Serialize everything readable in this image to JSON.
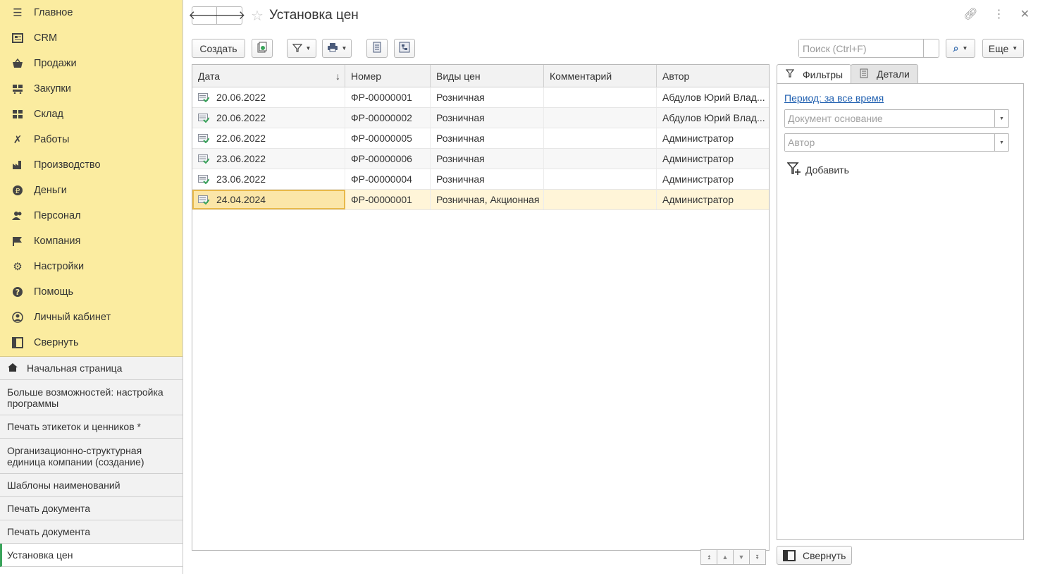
{
  "sidebar": {
    "sections": [
      {
        "label": "Главное",
        "icon": "menu-icon"
      },
      {
        "label": "CRM",
        "icon": "crm-icon"
      },
      {
        "label": "Продажи",
        "icon": "basket-icon"
      },
      {
        "label": "Закупки",
        "icon": "purchases-icon"
      },
      {
        "label": "Склад",
        "icon": "warehouse-icon"
      },
      {
        "label": "Работы",
        "icon": "tools-icon"
      },
      {
        "label": "Производство",
        "icon": "factory-icon"
      },
      {
        "label": "Деньги",
        "icon": "ruble-icon"
      },
      {
        "label": "Персонал",
        "icon": "people-icon"
      },
      {
        "label": "Компания",
        "icon": "flag-icon"
      },
      {
        "label": "Настройки",
        "icon": "gear-icon"
      },
      {
        "label": "Помощь",
        "icon": "help-icon"
      },
      {
        "label": "Личный кабинет",
        "icon": "user-circle-icon"
      },
      {
        "label": "Свернуть",
        "icon": "collapse-icon"
      }
    ],
    "history": [
      {
        "label": "Начальная страница",
        "type": "home"
      },
      {
        "label": "Больше возможностей: настройка программы",
        "type": "double"
      },
      {
        "label": "Печать этикеток и ценников *",
        "type": "single"
      },
      {
        "label": "Организационно-структурная единица компании (создание)",
        "type": "double"
      },
      {
        "label": "Шаблоны наименований",
        "type": "single"
      },
      {
        "label": "Печать документа",
        "type": "single"
      },
      {
        "label": "Печать документа",
        "type": "single"
      },
      {
        "label": "Установка цен",
        "type": "active"
      }
    ]
  },
  "header": {
    "title": "Установка цен",
    "back_icon": "arrow-left-icon",
    "forward_icon": "arrow-right-icon"
  },
  "toolbar": {
    "create_label": "Создать",
    "search_placeholder": "Поиск (Ctrl+F)",
    "more_label": "Еще"
  },
  "table": {
    "columns": [
      "Дата",
      "Номер",
      "Виды цен",
      "Комментарий",
      "Автор"
    ],
    "sorted_column": "Дата",
    "sort_direction": "descending",
    "rows": [
      {
        "date": "20.06.2022",
        "number": "ФР-00000001",
        "price_types": "Розничная",
        "comment": "",
        "author": "Абдулов Юрий Влад..."
      },
      {
        "date": "20.06.2022",
        "number": "ФР-00000002",
        "price_types": "Розничная",
        "comment": "",
        "author": "Абдулов Юрий Влад..."
      },
      {
        "date": "22.06.2022",
        "number": "ФР-00000005",
        "price_types": "Розничная",
        "comment": "",
        "author": "Администратор"
      },
      {
        "date": "23.06.2022",
        "number": "ФР-00000006",
        "price_types": "Розничная",
        "comment": "",
        "author": "Администратор"
      },
      {
        "date": "23.06.2022",
        "number": "ФР-00000004",
        "price_types": "Розничная",
        "comment": "",
        "author": "Администратор"
      },
      {
        "date": "24.04.2024",
        "number": "ФР-00000001",
        "price_types": "Розничная, Акционная",
        "comment": "",
        "author": "Администратор"
      }
    ],
    "selected_row": 5
  },
  "panel": {
    "tab_filters": "Фильтры",
    "tab_details": "Детали",
    "period_link": "Период: за все время",
    "doc_basis_placeholder": "Документ основание",
    "author_placeholder": "Автор",
    "add_label": "Добавить",
    "collapse_label": "Свернуть"
  },
  "colors": {
    "sidebar_bg": "#fbeca0",
    "selected_row": "#fff5d8",
    "link": "#1f5fb0",
    "active_marker": "#3aa45b"
  }
}
